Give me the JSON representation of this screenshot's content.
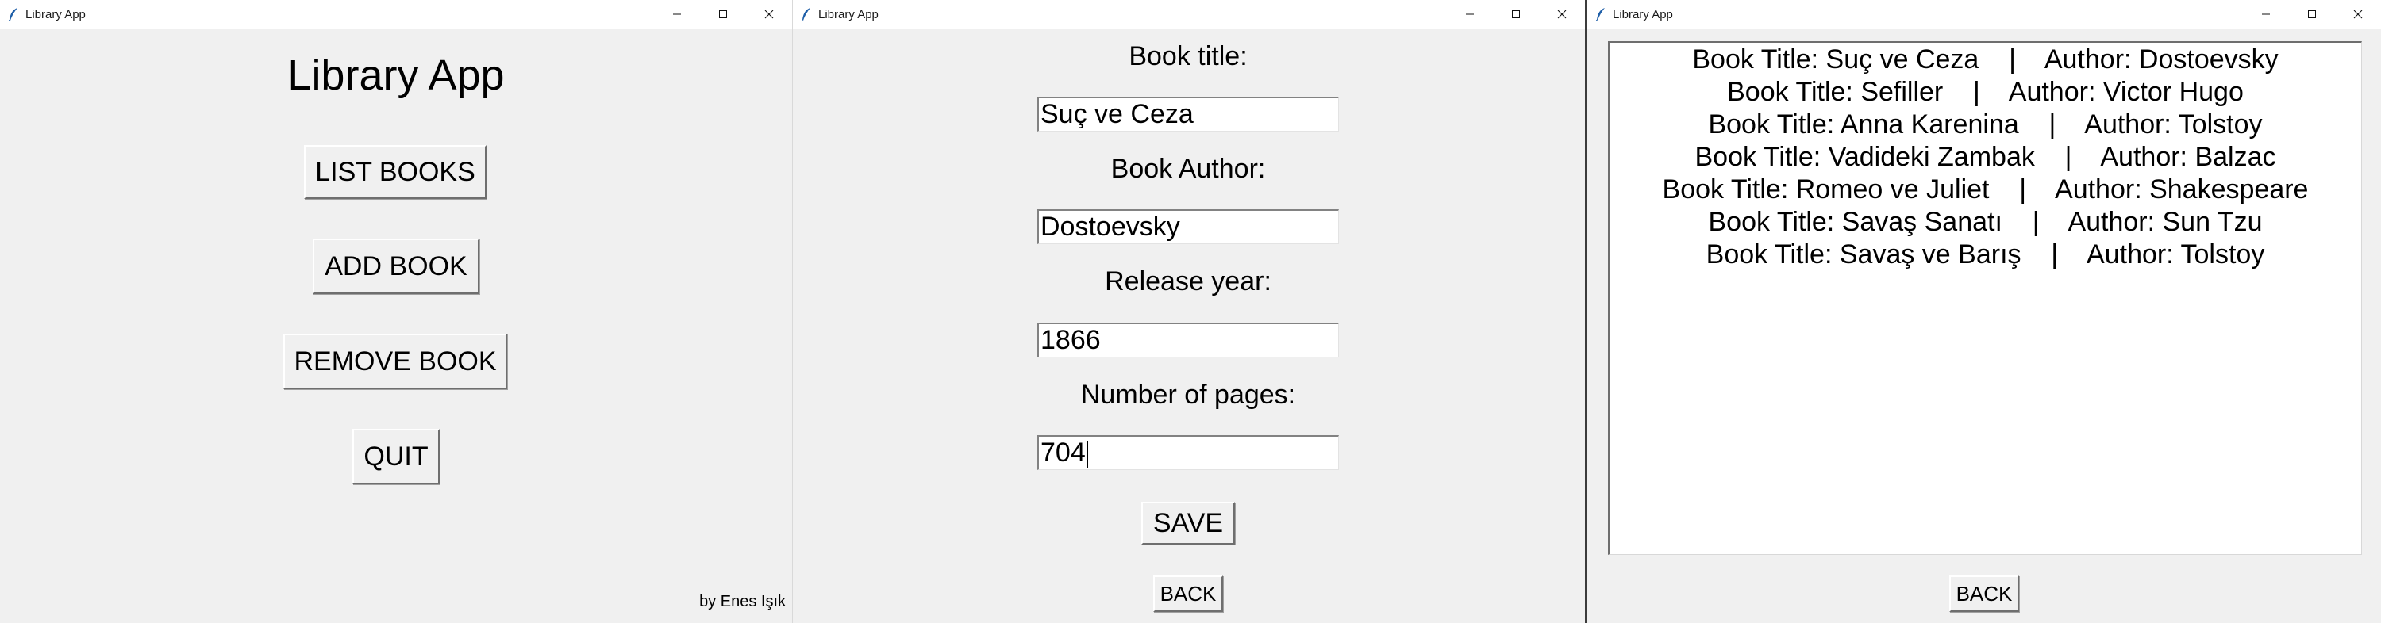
{
  "windows": {
    "menu": {
      "title": "Library App",
      "heading": "Library App",
      "buttons": {
        "list_books": "LIST BOOKS",
        "add_book": "ADD BOOK",
        "remove_book": "REMOVE BOOK",
        "quit": "QUIT"
      },
      "credit": "by Enes Işık"
    },
    "add_book": {
      "title": "Library App",
      "fields": {
        "title_label": "Book title:",
        "title_value": "Suç ve Ceza",
        "author_label": "Book Author:",
        "author_value": "Dostoevsky",
        "year_label": "Release year:",
        "year_value": "1866",
        "pages_label": "Number of pages:",
        "pages_value": "704"
      },
      "save_label": "SAVE",
      "back_label": "BACK"
    },
    "list_books": {
      "title": "Library App",
      "books": [
        "Book Title: Suç ve Ceza    |    Author: Dostoevsky",
        "Book Title: Sefiller    |    Author: Victor Hugo",
        "Book Title: Anna Karenina    |    Author: Tolstoy",
        "Book Title: Vadideki Zambak    |    Author: Balzac",
        "Book Title: Romeo ve Juliet    |    Author: Shakespeare",
        "Book Title: Savaş Sanatı    |    Author: Sun Tzu",
        "Book Title: Savaş ve Barış    |    Author: Tolstoy"
      ],
      "back_label": "BACK"
    }
  },
  "icons": {
    "app": "feather-icon",
    "minimize": "minimize-icon",
    "maximize": "maximize-icon",
    "close": "close-icon"
  }
}
